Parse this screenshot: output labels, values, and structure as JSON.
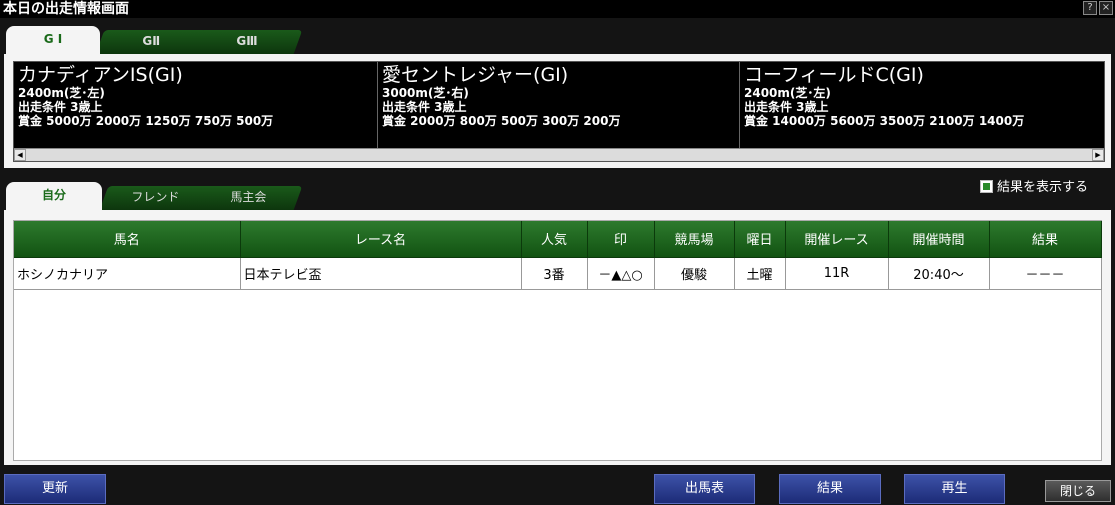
{
  "window": {
    "title": "本日の出走情報画面",
    "help_label": "?",
    "close_label": "×"
  },
  "grade_tabs": [
    {
      "label": "G I"
    },
    {
      "label": "GⅡ"
    },
    {
      "label": "GⅢ"
    }
  ],
  "races": [
    {
      "name": "カナディアンIS(GⅠ)",
      "distance": "2400m(芝･左)",
      "condition": "出走条件 3歳上",
      "prize": "賞金  5000万 2000万 1250万 750万 500万"
    },
    {
      "name": "愛セントレジャー(GⅠ)",
      "distance": "3000m(芝･右)",
      "condition": "出走条件 3歳上",
      "prize": "賞金  2000万 800万 500万 300万 200万"
    },
    {
      "name": "コーフィールドC(GⅠ)",
      "distance": "2400m(芝･左)",
      "condition": "出走条件 3歳上",
      "prize": "賞金  14000万 5600万 3500万 2100万 1400万"
    }
  ],
  "scroll": {
    "left": "◀",
    "right": "▶"
  },
  "sub_tabs": [
    {
      "label": "自分"
    },
    {
      "label": "フレンド"
    },
    {
      "label": "馬主会"
    }
  ],
  "show_result_label": "結果を表示する",
  "table": {
    "headers": [
      "馬名",
      "レース名",
      "人気",
      "印",
      "競馬場",
      "曜日",
      "開催レース",
      "開催時間",
      "結果"
    ],
    "rows": [
      [
        "ホシノカナリア",
        "日本テレビ盃",
        "3番",
        "－▲△○",
        "優駿",
        "土曜",
        "11R",
        "20:40～",
        "－－－"
      ]
    ]
  },
  "buttons": {
    "refresh": "更新",
    "race_card": "出馬表",
    "result": "結果",
    "replay": "再生",
    "close": "閉じる"
  },
  "colors": {
    "accent_green": "#1a6a1a",
    "button_blue": "#2a3d92"
  }
}
